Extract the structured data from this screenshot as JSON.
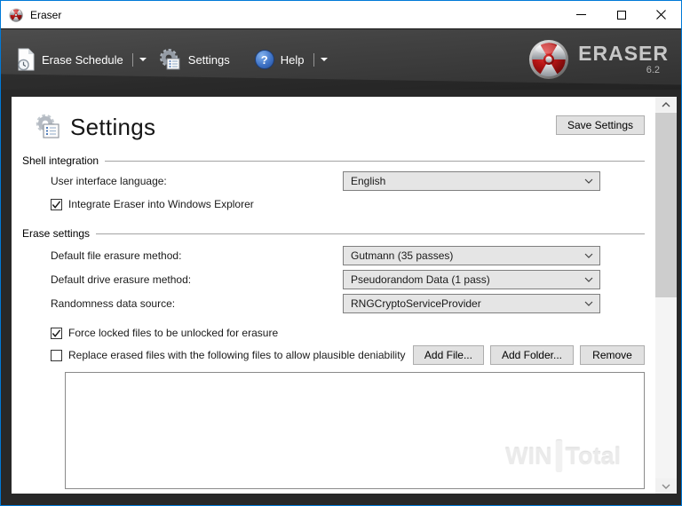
{
  "window": {
    "title": "Eraser"
  },
  "toolbar": {
    "items": [
      {
        "label": "Erase Schedule",
        "has_dropdown": true
      },
      {
        "label": "Settings",
        "has_dropdown": false
      },
      {
        "label": "Help",
        "has_dropdown": true
      }
    ],
    "help_glyph": "?",
    "logo": {
      "name": "ERASER",
      "version": "6.2"
    }
  },
  "page": {
    "title": "Settings",
    "save_button": "Save Settings"
  },
  "shell_integration": {
    "group_label": "Shell integration",
    "language_label": "User interface language:",
    "language_value": "English",
    "integrate_checkbox": {
      "label": "Integrate Eraser into Windows Explorer",
      "checked": true
    }
  },
  "erase_settings": {
    "group_label": "Erase settings",
    "rows": [
      {
        "label": "Default file erasure method:",
        "value": "Gutmann (35 passes)"
      },
      {
        "label": "Default drive erasure method:",
        "value": "Pseudorandom Data (1 pass)"
      },
      {
        "label": "Randomness data source:",
        "value": "RNGCryptoServiceProvider"
      }
    ],
    "force_locked_checkbox": {
      "label": "Force locked files to be unlocked for erasure",
      "checked": true
    },
    "replace_checkbox": {
      "label": "Replace erased files with the following files to allow plausible deniability",
      "checked": false
    },
    "buttons": {
      "add_file": "Add File...",
      "add_folder": "Add Folder...",
      "remove": "Remove"
    },
    "file_list": []
  },
  "watermark": {
    "left": "WIN",
    "right": "Total"
  },
  "colors": {
    "accent_blue": "#0079d7",
    "toolbar_dark": "#3a3a3a",
    "logo_red": "#a31212",
    "help_blue": "#3f73c6"
  }
}
